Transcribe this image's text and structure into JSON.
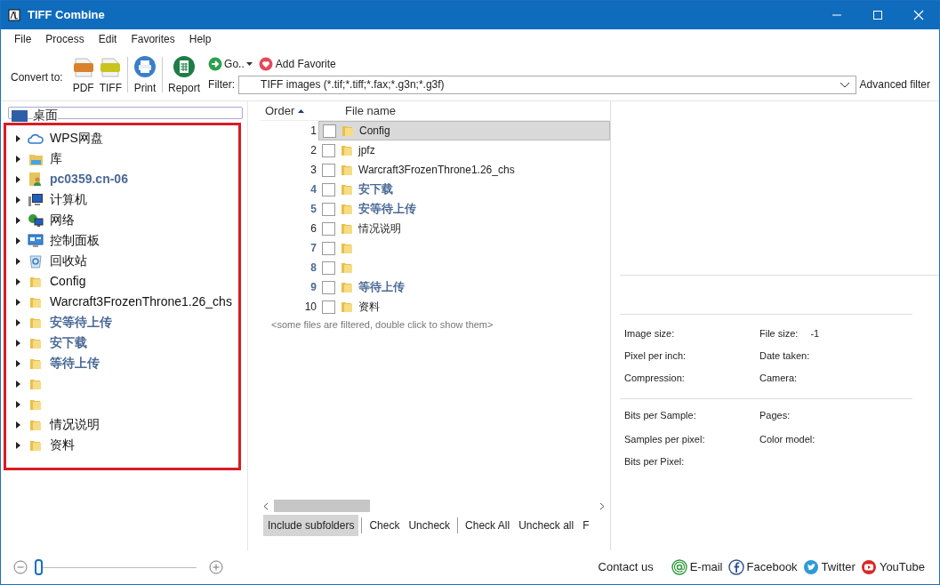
{
  "window": {
    "title": "TIFF Combine"
  },
  "menu": [
    "File",
    "Process",
    "Edit",
    "Favorites",
    "Help"
  ],
  "toolbar": {
    "convert_label": "Convert to:",
    "buttons": [
      {
        "kind": "pdf",
        "label": "PDF"
      },
      {
        "kind": "tiff",
        "label": "TIFF"
      },
      {
        "kind": "print",
        "label": "Print"
      },
      {
        "kind": "report",
        "label": "Report"
      }
    ],
    "go": "Go..",
    "add_favorite": "Add Favorite",
    "filter_label": "Filter:",
    "filter_value": "TIFF images (*.tif;*.tiff;*.fax;*.g3n;*.g3f)",
    "advanced_filter": "Advanced filter"
  },
  "tree": {
    "root": "桌面",
    "items": [
      {
        "kind": "cloud",
        "label": "WPS网盘",
        "emphasized": false,
        "expanded": false
      },
      {
        "kind": "library",
        "label": "库",
        "emphasized": false,
        "expanded": false
      },
      {
        "kind": "user",
        "label": "pc0359.cn-06",
        "emphasized": true,
        "expanded": false
      },
      {
        "kind": "computer",
        "label": "计算机",
        "emphasized": false,
        "expanded": false
      },
      {
        "kind": "network",
        "label": "网络",
        "emphasized": false,
        "expanded": false
      },
      {
        "kind": "control-panel",
        "label": "控制面板",
        "emphasized": false,
        "expanded": false
      },
      {
        "kind": "recycle",
        "label": "回收站",
        "emphasized": false,
        "expanded": false
      },
      {
        "kind": "folder",
        "label": "Config",
        "emphasized": false,
        "expanded": false
      },
      {
        "kind": "folder",
        "label": "Warcraft3FrozenThrone1.26_chs",
        "emphasized": false,
        "expanded": false
      },
      {
        "kind": "folder",
        "label": "安等待上传",
        "emphasized": true,
        "expanded": false
      },
      {
        "kind": "folder",
        "label": "安下载",
        "emphasized": true,
        "expanded": false
      },
      {
        "kind": "folder",
        "label": "等待上传",
        "emphasized": true,
        "expanded": false
      },
      {
        "kind": "folder",
        "expanded": false
      },
      {
        "kind": "folder",
        "expanded": false
      },
      {
        "kind": "folder",
        "label": "情况说明",
        "emphasized": false,
        "expanded": false
      },
      {
        "kind": "folder",
        "label": "资料",
        "emphasized": false,
        "expanded": false
      }
    ]
  },
  "file_list": {
    "columns": [
      "Order",
      "File name"
    ],
    "rows": [
      {
        "order": "1",
        "name": "Config",
        "emphasized": false,
        "checked": false,
        "selected": true
      },
      {
        "order": "2",
        "name": "jpfz",
        "emphasized": false,
        "checked": false,
        "selected": false
      },
      {
        "order": "3",
        "name": "Warcraft3FrozenThrone1.26_chs",
        "emphasized": false,
        "checked": false,
        "selected": false
      },
      {
        "order": "4",
        "name": "安下载",
        "emphasized": true,
        "checked": false,
        "selected": false
      },
      {
        "order": "5",
        "name": "安等待上传",
        "emphasized": true,
        "checked": false,
        "selected": false
      },
      {
        "order": "6",
        "name": "情况说明",
        "emphasized": false,
        "checked": false,
        "selected": false
      },
      {
        "order": "7",
        "emphasized": true,
        "checked": false,
        "selected": false
      },
      {
        "order": "8",
        "emphasized": true,
        "checked": false,
        "selected": false
      },
      {
        "order": "9",
        "name": "等待上传",
        "emphasized": true,
        "checked": false,
        "selected": false
      },
      {
        "order": "10",
        "name": "资料",
        "emphasized": false,
        "checked": false,
        "selected": false
      }
    ],
    "note": "<some files are filtered, double click to show them>",
    "actions": [
      {
        "label": "Include subfolders",
        "selected": true
      },
      {
        "label": "Check",
        "selected": false
      },
      {
        "label": "Uncheck",
        "selected": false
      },
      {
        "label": "Check All",
        "selected": false
      },
      {
        "label": "Uncheck all",
        "selected": false
      },
      {
        "label": "F",
        "selected": false
      }
    ]
  },
  "details": [
    [
      {
        "label": "Image size:"
      },
      {
        "label": "File size:",
        "value": "-1"
      }
    ],
    [
      {
        "label": "Pixel per inch:"
      },
      {
        "label": "Date taken:"
      }
    ],
    [
      {
        "label": "Compression:"
      },
      {
        "label": "Camera:"
      }
    ],
    [
      {
        "label": "Bits per Sample:"
      },
      {
        "label": "Pages:"
      }
    ],
    [
      {
        "label": "Samples per pixel:"
      },
      {
        "label": "Color model:"
      }
    ],
    [
      {
        "label": "Bits per Pixel:"
      }
    ]
  ],
  "zoom": {
    "level": 0.0
  },
  "footer": {
    "contact": "Contact us",
    "links": [
      {
        "kind": "email",
        "label": "E-mail"
      },
      {
        "kind": "facebook",
        "label": "Facebook"
      },
      {
        "kind": "twitter",
        "label": "Twitter"
      },
      {
        "kind": "youtube",
        "label": "YouTube"
      }
    ]
  }
}
